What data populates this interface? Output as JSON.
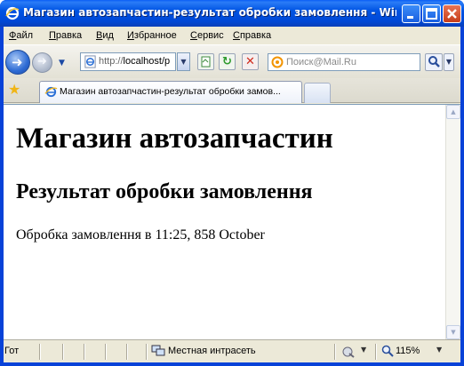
{
  "window": {
    "title": "Магазин автозапчастин-результат обробки замовлення - Windo...",
    "accent_color": "#0054e3"
  },
  "menu": {
    "items": [
      "Файл",
      "Правка",
      "Вид",
      "Избранное",
      "Сервис",
      "Справка"
    ]
  },
  "toolbar": {
    "address_prefix": "http://",
    "address_host": "localhost/p",
    "search_placeholder": "Поиск@Mail.Ru"
  },
  "tabs": {
    "active_label": "Магазин автозапчастин-результат обробки замов..."
  },
  "page": {
    "heading": "Магазин автозапчастин",
    "subheading": "Результат обробки замовлення",
    "paragraph": "Обробка замовлення в 11:25, 858 October"
  },
  "status": {
    "text": "Гот",
    "zone": "Местная интрасеть",
    "zoom": "115%"
  }
}
